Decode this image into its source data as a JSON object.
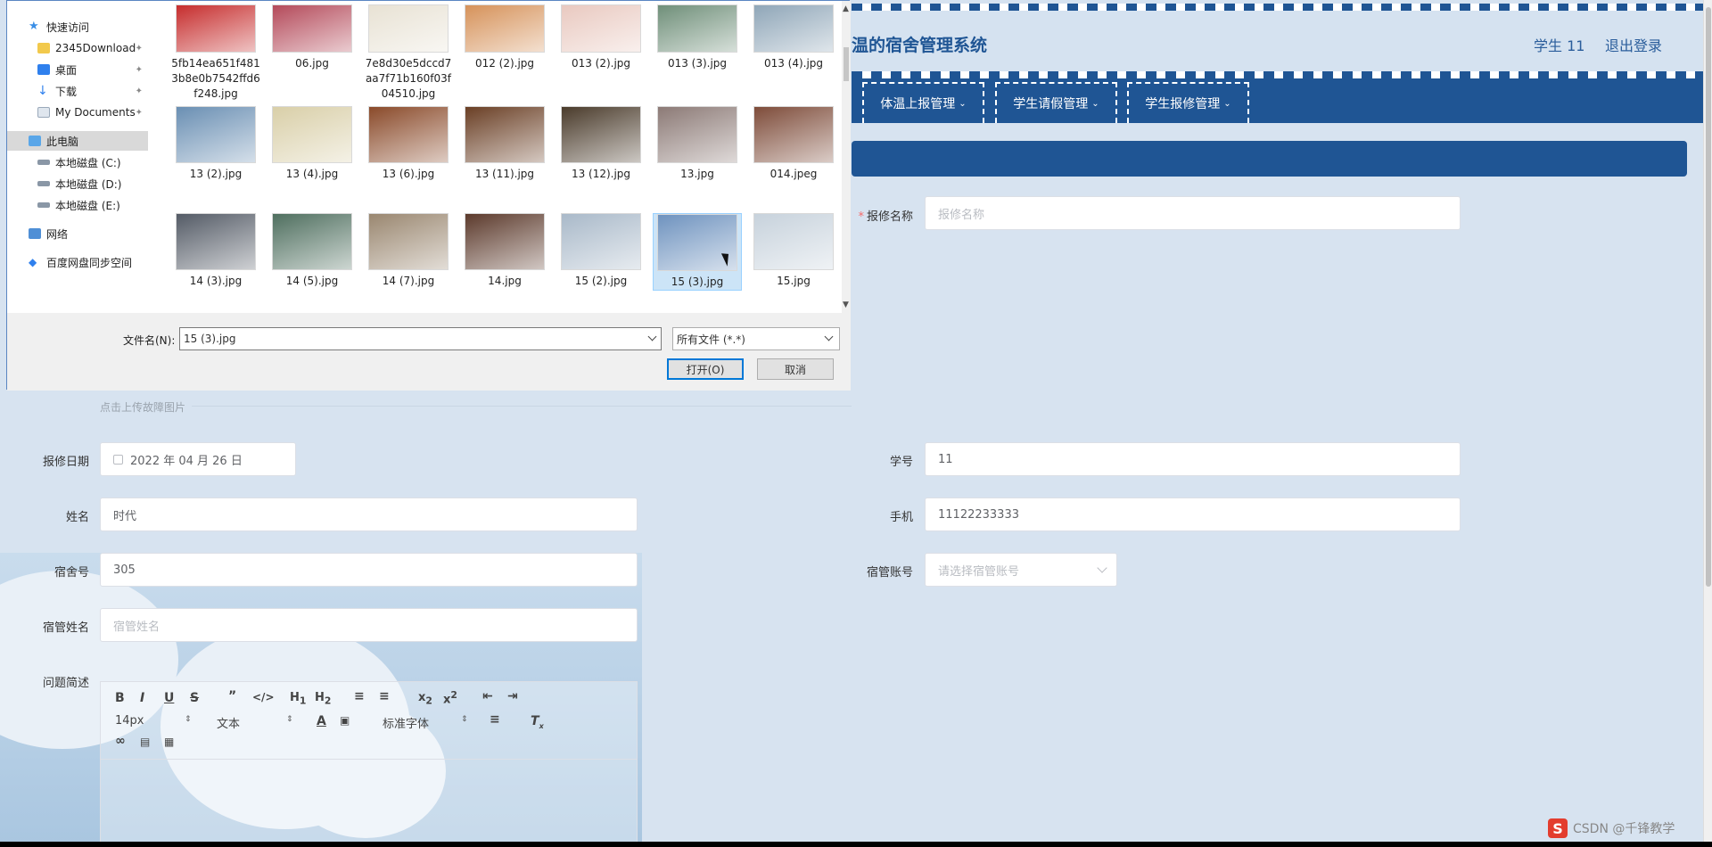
{
  "app": {
    "title": "温的宿舍管理系统",
    "user": "学生 11",
    "logout": "退出登录"
  },
  "nav": [
    {
      "label": "体温上报管理"
    },
    {
      "label": "学生请假管理"
    },
    {
      "label": "学生报修管理"
    }
  ],
  "form": {
    "repair_name": {
      "label": "报修名称",
      "placeholder": "报修名称"
    },
    "upload_hint": "点击上传故障图片",
    "repair_date": {
      "label": "报修日期",
      "value": "2022 年 04 月 26 日"
    },
    "student_no": {
      "label": "学号",
      "value": "11"
    },
    "name": {
      "label": "姓名",
      "value": "时代"
    },
    "phone": {
      "label": "手机",
      "value": "11122233333"
    },
    "dorm_no": {
      "label": "宿舍号",
      "value": "305"
    },
    "manager_account": {
      "label": "宿管账号",
      "placeholder": "请选择宿管账号"
    },
    "manager_name": {
      "label": "宿管姓名",
      "placeholder": "宿管姓名"
    },
    "description": {
      "label": "问题简述"
    }
  },
  "editor": {
    "font_size": "14px",
    "text_type": "文本",
    "font_family": "标准字体"
  },
  "dialog": {
    "sidebar": [
      {
        "label": "快速访问",
        "icon": "star-icon"
      },
      {
        "label": "2345Download",
        "icon": "folder-icon"
      },
      {
        "label": "桌面",
        "icon": "desktop-icon"
      },
      {
        "label": "下载",
        "icon": "download-icon"
      },
      {
        "label": "My Documents",
        "icon": "document-icon"
      },
      {
        "label": "此电脑",
        "icon": "computer-icon"
      },
      {
        "label": "本地磁盘 (C:)",
        "icon": "drive-icon"
      },
      {
        "label": "本地磁盘 (D:)",
        "icon": "drive-icon"
      },
      {
        "label": "本地磁盘 (E:)",
        "icon": "drive-icon"
      },
      {
        "label": "网络",
        "icon": "network-icon"
      },
      {
        "label": "百度网盘同步空间",
        "icon": "cloud-icon"
      }
    ],
    "files": [
      {
        "name": "5fb14ea651f4813b8e0b7542ffd6f248.jpg",
        "color": "#c62d2d"
      },
      {
        "name": "06.jpg",
        "color": "#b44a5a"
      },
      {
        "name": "7e8d30e5dccd7aa7f71b160f03f04510.jpg",
        "color": "#e8e2d4"
      },
      {
        "name": "012 (2).jpg",
        "color": "#d6925a"
      },
      {
        "name": "013 (2).jpg",
        "color": "#e9c9c0"
      },
      {
        "name": "013 (3).jpg",
        "color": "#6f8f79"
      },
      {
        "name": "013 (4).jpg",
        "color": "#8fa6b8"
      },
      {
        "name": "13 (2).jpg",
        "color": "#6a8fb3"
      },
      {
        "name": "13 (4).jpg",
        "color": "#d9cfa8"
      },
      {
        "name": "13 (6).jpg",
        "color": "#8a4a2a"
      },
      {
        "name": "13 (11).jpg",
        "color": "#6a3f25"
      },
      {
        "name": "13 (12).jpg",
        "color": "#4a3b2b"
      },
      {
        "name": "13.jpg",
        "color": "#8c7a76"
      },
      {
        "name": "014.jpeg",
        "color": "#7e4c3a"
      },
      {
        "name": "14 (3).jpg",
        "color": "#545b66"
      },
      {
        "name": "14 (5).jpg",
        "color": "#4f6f5f"
      },
      {
        "name": "14 (7).jpg",
        "color": "#9a8770"
      },
      {
        "name": "14.jpg",
        "color": "#5c3a2c"
      },
      {
        "name": "15 (2).jpg",
        "color": "#a9b9c9"
      },
      {
        "name": "15 (3).jpg",
        "color": "#6f93bf"
      },
      {
        "name": "15.jpg",
        "color": "#c7d2dc"
      }
    ],
    "filename_label": "文件名(N):",
    "filename_value": "15 (3).jpg",
    "filetype": "所有文件 (*.*)",
    "open_button": "打开(O)",
    "cancel_button": "取消"
  },
  "watermark": "CSDN @千锋教学",
  "colors": {
    "primary": "#1f5594",
    "background": "#d7e3f0"
  }
}
